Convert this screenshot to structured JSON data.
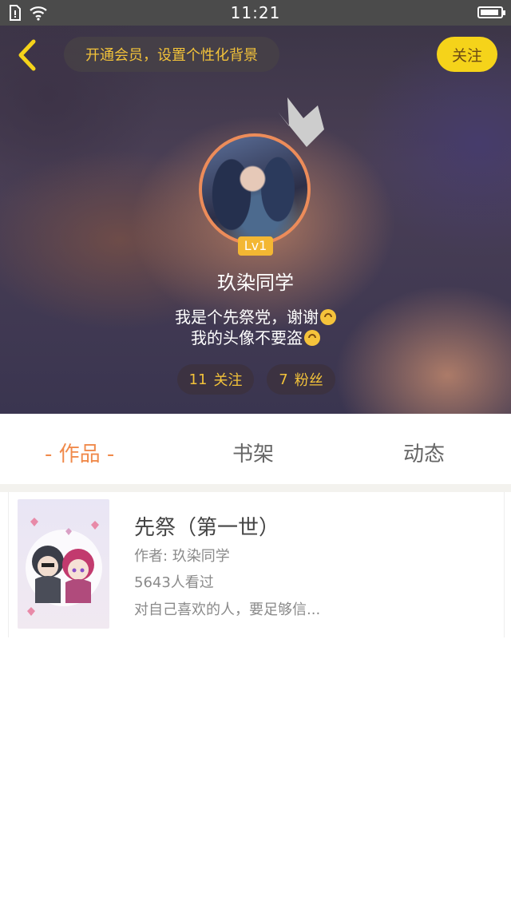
{
  "status_bar": {
    "time": "11:21"
  },
  "header": {
    "vip_prompt": "开通会员，设置个性化背景",
    "follow_label": "关注",
    "level_badge": "Lv1",
    "nickname": "玖染同学",
    "bio_line1": "我是个先祭党，谢谢",
    "bio_line2": "我的头像不要盗",
    "following_count": "11",
    "following_label": "关注",
    "followers_count": "7",
    "followers_label": "粉丝"
  },
  "tabs": [
    {
      "label": "- 作品 -",
      "active": true
    },
    {
      "label": "书架",
      "active": false
    },
    {
      "label": "动态",
      "active": false
    }
  ],
  "works": [
    {
      "title": "先祭（第一世）",
      "author_label": "作者: ",
      "author": "玖染同学",
      "views": "5643人看过",
      "summary": "对自己喜欢的人，要足够信..."
    }
  ],
  "colors": {
    "accent_orange": "#f08a4b",
    "accent_yellow": "#f5d31a",
    "stat_text": "#f2c23a"
  },
  "icons": [
    "back-arrow-icon",
    "crown-icon",
    "wifi-icon",
    "sim-icon",
    "battery-icon",
    "smile-upside-down-emoji"
  ]
}
